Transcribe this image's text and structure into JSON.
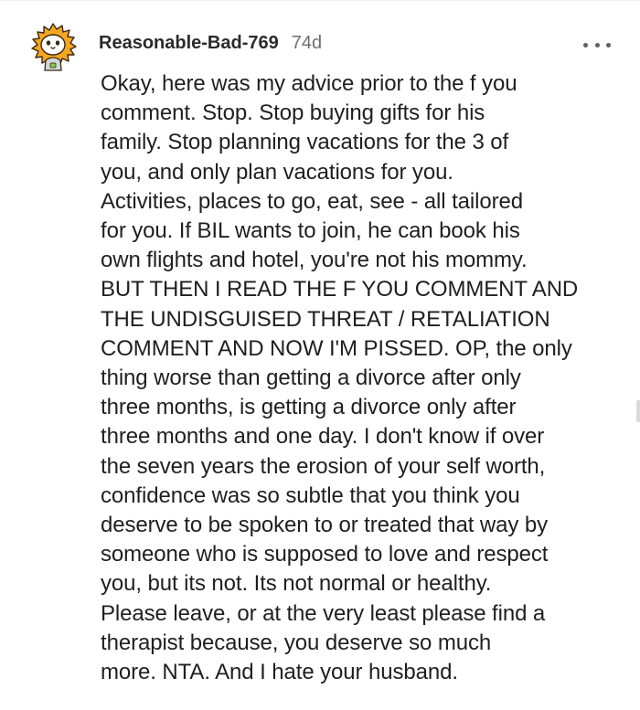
{
  "comment": {
    "username": "Reasonable-Bad-769",
    "age": "74d",
    "body": "Okay, here was my advice prior to the f you\ncomment. Stop. Stop buying gifts for his\nfamily. Stop planning vacations for the 3 of\nyou, and only plan vacations for you.\nActivities, places to go, eat, see - all tailored\nfor you. If BIL wants to join, he can book his\nown flights and hotel, you're not his mommy.\nBUT THEN I READ THE F YOU COMMENT AND\nTHE UNDISGUISED THREAT / RETALIATION\nCOMMENT AND NOW I'M PISSED. OP, the only\nthing worse than getting a divorce after only\nthree months, is getting a divorce only after\nthree months and one day. I don't know if over\nthe seven years the erosion of your self worth,\nconfidence was so subtle that you think you\ndeserve to be spoken to or treated that way by\nsomeone who is supposed to love and respect\nyou, but its not. Its not normal or healthy.\nPlease leave, or at the very least please find a\ntherapist because, you deserve so much\nmore. NTA. And I hate your husband."
  },
  "icons": {
    "avatar": "snoo-avatar-icon",
    "more": "more-options-icon"
  },
  "colors": {
    "username": "#2b2b2b",
    "timestamp": "#6d6e70",
    "body": "#1f1f1f",
    "avatar_accent": "#f5a623"
  }
}
